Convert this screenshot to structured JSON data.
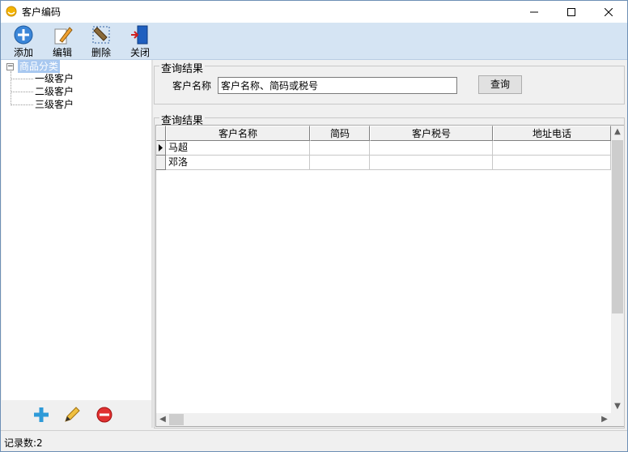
{
  "window": {
    "title": "客户编码"
  },
  "toolbar": {
    "add_label": "添加",
    "edit_label": "编辑",
    "delete_label": "删除",
    "close_label": "关闭"
  },
  "tree": {
    "root": "商品分类",
    "children": [
      "一级客户",
      "二级客户",
      "三级客户"
    ]
  },
  "query": {
    "group_title": "查询结果",
    "label": "客户名称",
    "input_value": "客户名称、简码或税号",
    "button_label": "查询"
  },
  "results": {
    "group_title": "查询结果",
    "columns": [
      "客户名称",
      "简码",
      "客户税号",
      "地址电话"
    ],
    "rows": [
      [
        "马超",
        "",
        "",
        ""
      ],
      [
        "邓洛",
        "",
        "",
        ""
      ]
    ]
  },
  "status": {
    "text": "记录数:2"
  },
  "colors": {
    "toolbar_bg": "#d5e4f3",
    "selection": "#a8c8f0",
    "delete_red": "#e03030"
  }
}
